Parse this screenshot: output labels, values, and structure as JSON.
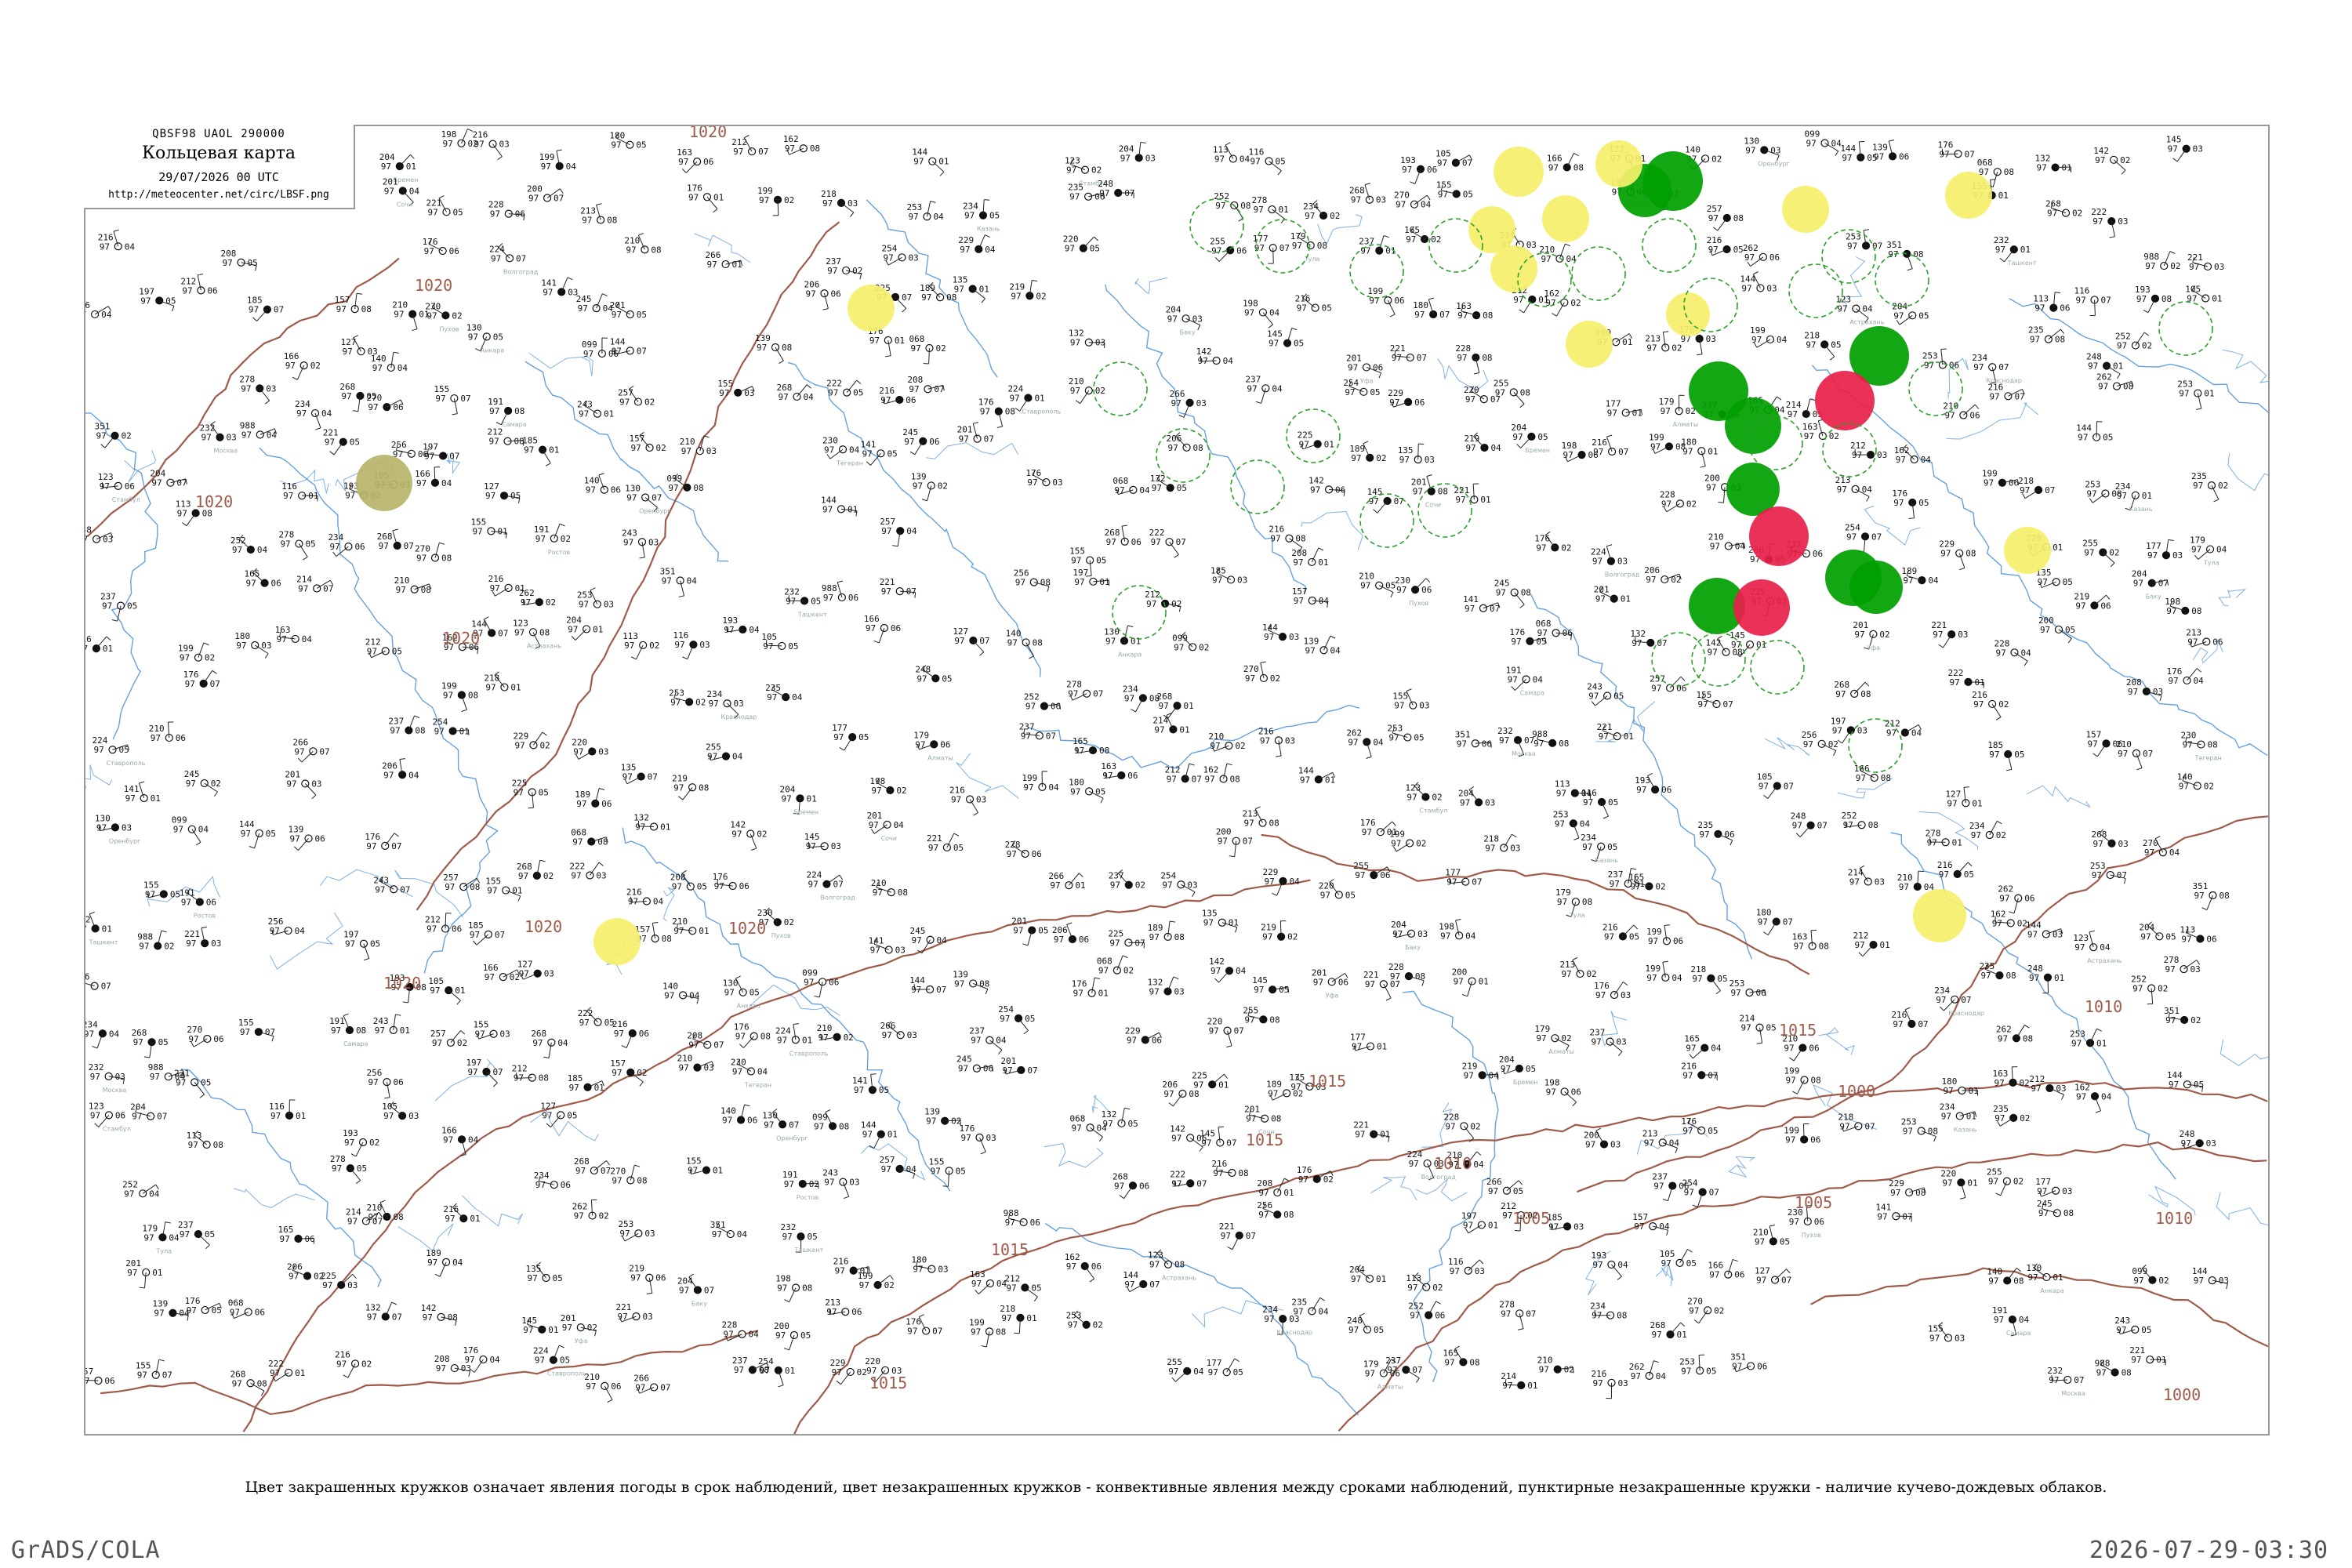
{
  "header": {
    "code": "QBSF98  UAOL  290000",
    "title": "Кольцевая карта",
    "datetime": "29/07/2026 00 UTC",
    "url": "http://meteocenter.net/circ/LBSF.png"
  },
  "caption": "Цвет закрашенных кружков означает явления погоды в срок наблюдений, цвет незакрашенных кружков - конвективные явления между сроками наблюдений, пунктирные незакрашенные кружки - наличие кучево-дождевых облаков.",
  "footer": {
    "left": "GrADS/COLA",
    "right": "2026-07-29-03:30"
  },
  "colors": {
    "isobar": "#a05a4a",
    "water": "#4a90d9",
    "fill_green": "#00a000",
    "fill_red": "#e8204a",
    "fill_yellow": "#f5f06a",
    "fill_olive": "#b7b46a",
    "ring_green": "#2aa02a"
  },
  "map": {
    "isobar_labels": [
      "1020",
      "1020",
      "1020",
      "1020",
      "1020",
      "1020",
      "1020",
      "1015",
      "1015",
      "1015",
      "1015",
      "1015",
      "1010",
      "1010",
      "1010",
      "1005",
      "1005",
      "1000",
      "1000"
    ],
    "station_values": [
      "204",
      "198",
      "216",
      "199",
      "180",
      "163",
      "212",
      "162",
      "144",
      "123",
      "204",
      "113",
      "116",
      "193",
      "105",
      "166",
      "127",
      "140",
      "130",
      "099",
      "144",
      "139",
      "176",
      "068",
      "132",
      "142",
      "145",
      "201",
      "221",
      "228",
      "200",
      "213",
      "176",
      "199",
      "218",
      "253",
      "234",
      "235",
      "248",
      "252",
      "278",
      "234",
      "268",
      "270",
      "155",
      "191",
      "243",
      "257",
      "155",
      "268",
      "222",
      "216",
      "208",
      "176",
      "224",
      "210",
      "266",
      "237",
      "254",
      "229",
      "220",
      "255",
      "177",
      "179",
      "237",
      "165",
      "214",
      "210",
      "216",
      "262",
      "253",
      "351",
      "232",
      "988",
      "221",
      "256",
      "197",
      "212",
      "185",
      "157",
      "210",
      "230",
      "141",
      "245",
      "201",
      "206",
      "225",
      "189",
      "135",
      "219"
    ],
    "station_names": [
      "Бремен",
      "Пухов",
      "Москва",
      "Тула",
      "Ставрополь",
      "Ростов",
      "Краснодар",
      "Сочи",
      "Анкара",
      "Стамбул",
      "Баку",
      "Тегеран",
      "Ташкент",
      "Алматы",
      "Волгоград",
      "Самара",
      "Казань",
      "Уфа",
      "Оренбург",
      "Астрахань"
    ]
  }
}
